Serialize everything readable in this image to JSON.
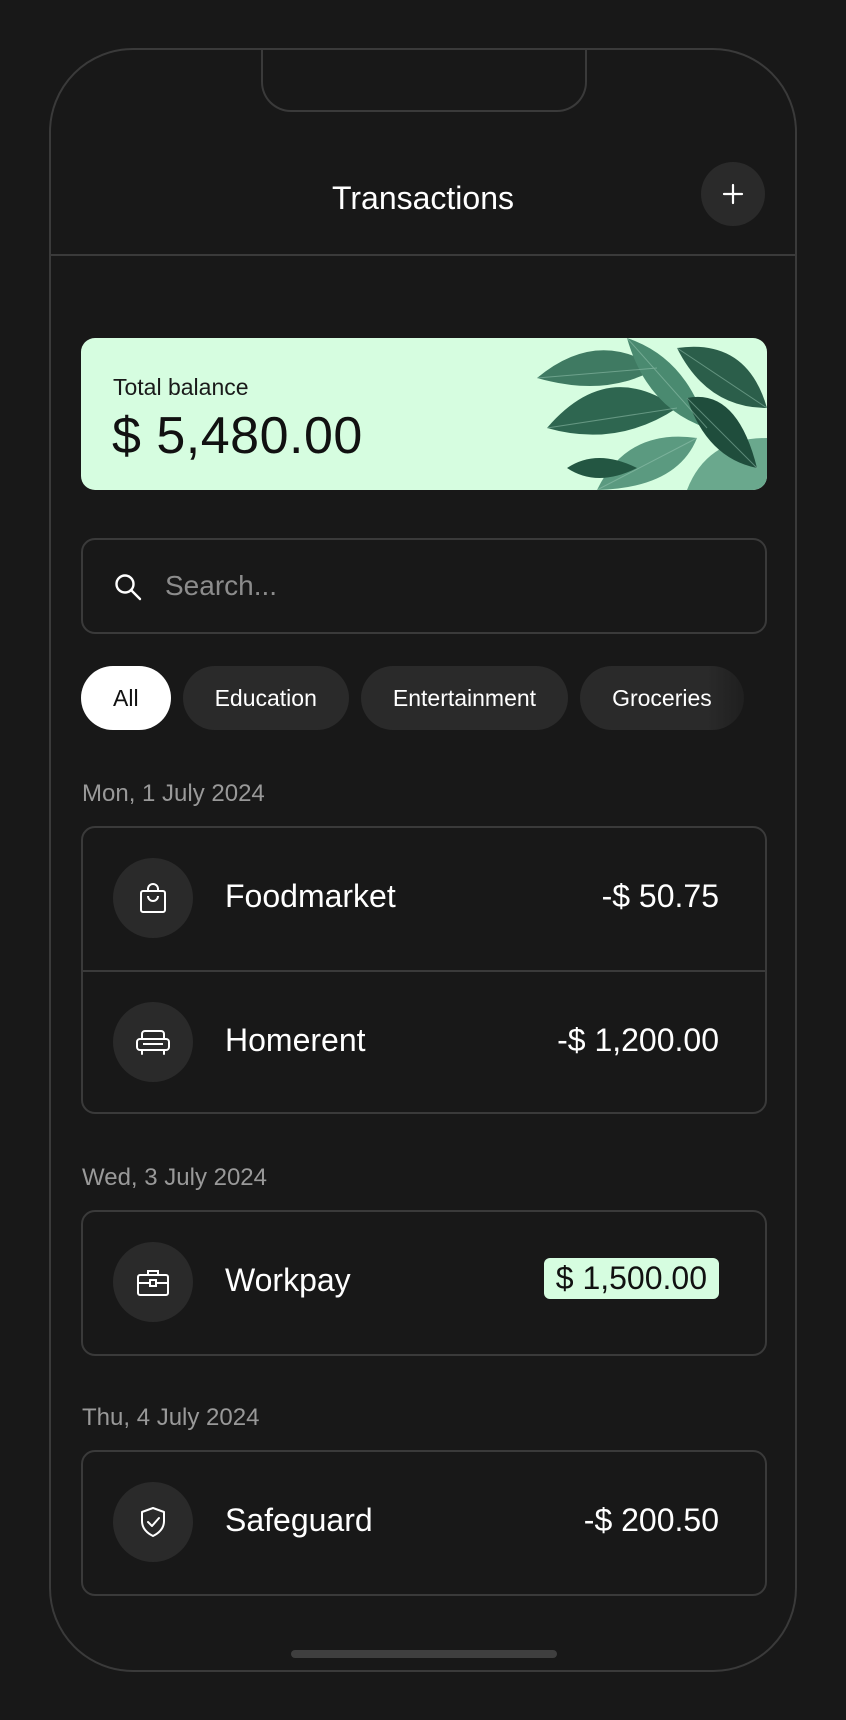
{
  "header": {
    "title": "Transactions",
    "add_icon": "plus-icon"
  },
  "balance": {
    "label": "Total balance",
    "amount": "$ 5,480.00",
    "accent": "#d6fde0"
  },
  "search": {
    "placeholder": "Search...",
    "value": "",
    "icon": "search-icon"
  },
  "filters": {
    "active": "All",
    "items": [
      "All",
      "Education",
      "Entertainment",
      "Groceries"
    ]
  },
  "groups": [
    {
      "date": "Mon, 1 July 2024",
      "transactions": [
        {
          "name": "Foodmarket",
          "amount": "-$ 50.75",
          "icon": "shopping-bag-icon"
        },
        {
          "name": "Homerent",
          "amount": "-$ 1,200.00",
          "icon": "sofa-icon"
        }
      ]
    },
    {
      "date": "Wed, 3 July 2024",
      "transactions": [
        {
          "name": "Workpay",
          "amount": "$ 1,500.00",
          "icon": "briefcase-icon",
          "income": true
        }
      ]
    },
    {
      "date": "Thu, 4 July 2024",
      "transactions": [
        {
          "name": "Safeguard",
          "amount": "-$ 200.50",
          "icon": "shield-check-icon"
        }
      ]
    }
  ]
}
